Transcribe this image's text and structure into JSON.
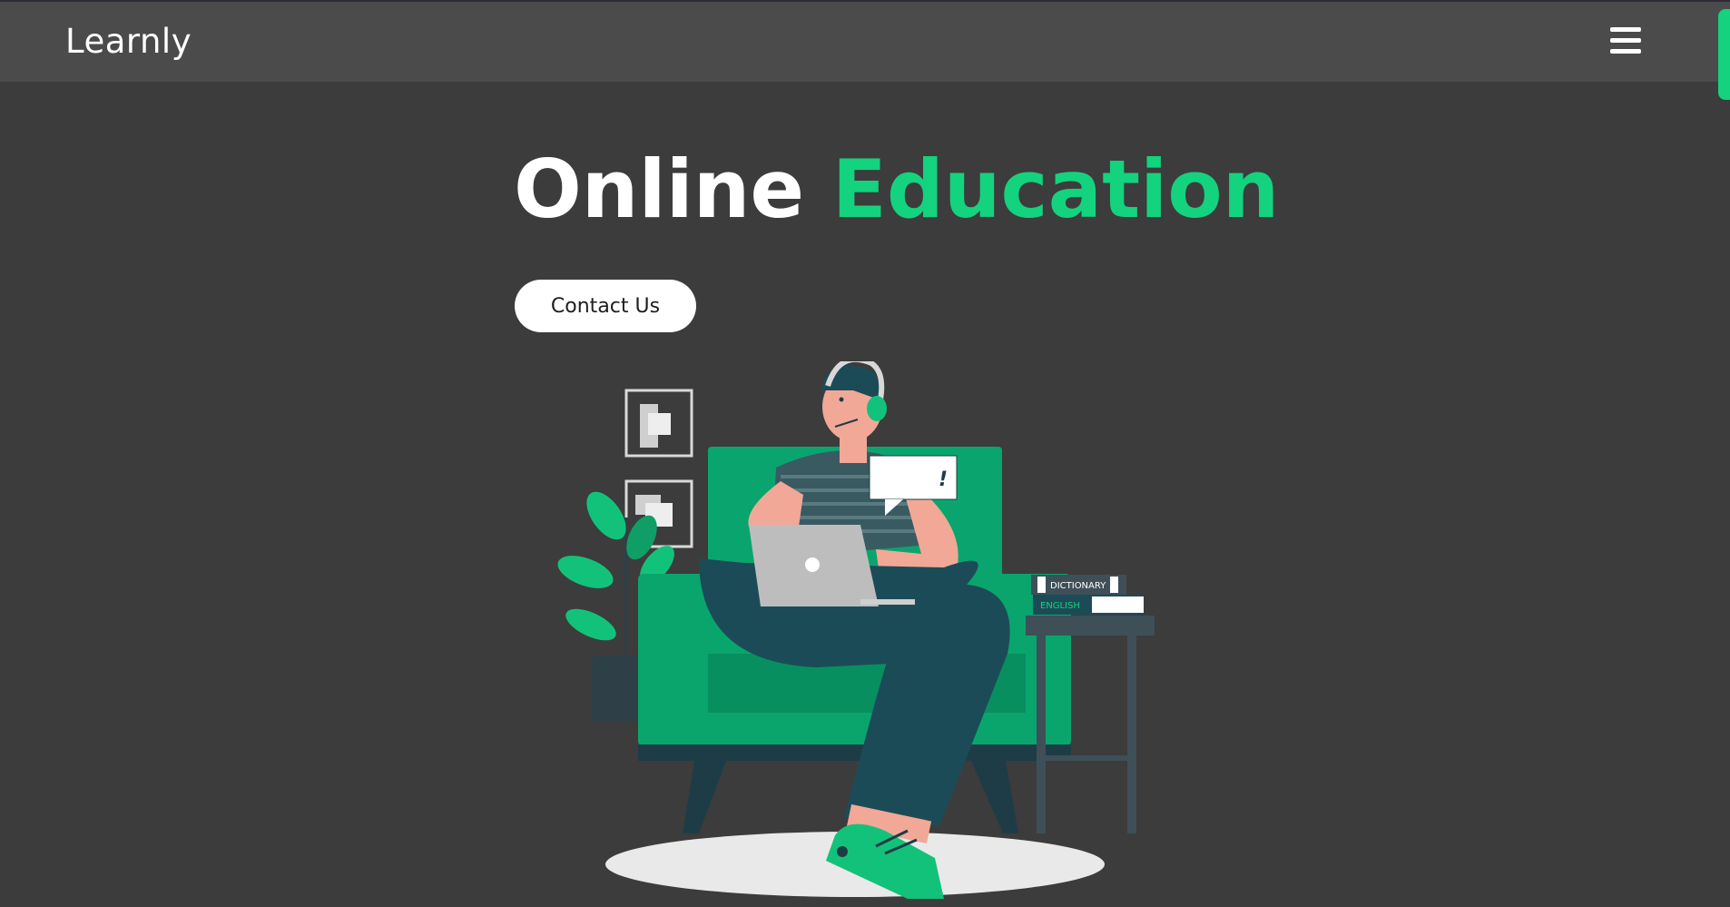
{
  "navbar": {
    "brand": "Learnly",
    "menu_icon": "hamburger-menu-icon"
  },
  "hero": {
    "title_part1": "Online",
    "title_part2": "Education",
    "contact_label": "Contact Us"
  },
  "illustration": {
    "books": {
      "top_label": "DICTIONARY",
      "bottom_label": "ENGLISH"
    },
    "speech_bubble_text": "!"
  },
  "colors": {
    "accent": "#13d37e",
    "background": "#3c3c3c",
    "navbar": "#4b4b4b",
    "illustration_green": "#0aa56e",
    "illustration_teal": "#1c4b58"
  }
}
